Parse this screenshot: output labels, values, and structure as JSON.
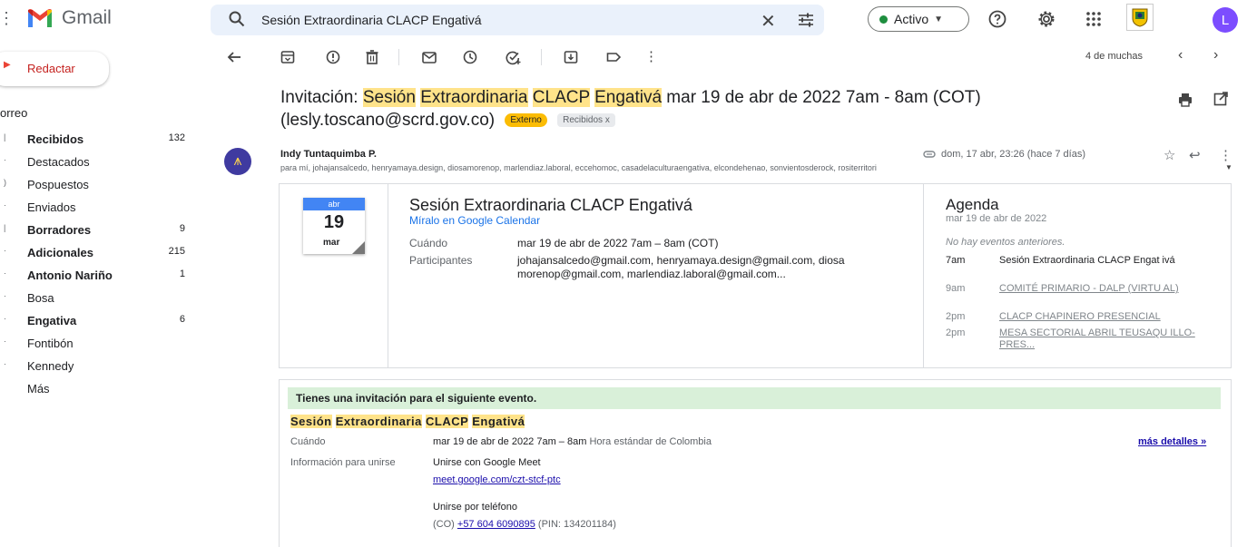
{
  "header": {
    "app_name": "Gmail",
    "search_value": "Sesión Extraordinaria CLACP Engativá",
    "status_label": "Activo",
    "avatar_letter": "L"
  },
  "sidebar": {
    "compose_label": "Redactar",
    "section_label": "orreo",
    "items": [
      {
        "label": "Recibidos",
        "count": "132",
        "bold": true
      },
      {
        "label": "Destacados",
        "count": ""
      },
      {
        "label": "Pospuestos",
        "count": ""
      },
      {
        "label": "Enviados",
        "count": ""
      },
      {
        "label": "Borradores",
        "count": "9",
        "bold": true
      },
      {
        "label": "Adicionales",
        "count": "215",
        "bold": true
      },
      {
        "label": "Antonio Nariño",
        "count": "1",
        "bold": true
      },
      {
        "label": "Bosa",
        "count": ""
      },
      {
        "label": "Engativa",
        "count": "6",
        "bold": true
      },
      {
        "label": "Fontibón",
        "count": ""
      },
      {
        "label": "Kennedy",
        "count": ""
      },
      {
        "label": "Más",
        "count": ""
      }
    ]
  },
  "toolbar": {
    "pager_text": "4 de muchas"
  },
  "message": {
    "subject_prefix": "Invitación: ",
    "subject_hl": [
      "Sesión",
      "Extraordinaria",
      "CLACP",
      "Engativá"
    ],
    "subject_suffix": " mar 19 de abr de 2022 7am - 8am (COT) (lesly.toscano@scrd.gov.co)",
    "tag_external": "Externo",
    "tag_inbox": "Recibidos x",
    "sender_name": "Indy Tuntaquimba P.",
    "recipients": "para mí, johajansalcedo, henryamaya.design, diosamorenop, marlendiaz.laboral, eccehomoc, casadelaculturaengativa, elcondehenao, sonvientosderock, rositerritori",
    "date": "dom, 17 abr, 23:26 (hace 7 días)"
  },
  "invite": {
    "cal_month": "abr",
    "cal_day": "19",
    "cal_weekday": "mar",
    "title": "Sesión Extraordinaria CLACP Engativá",
    "calendar_link": "Míralo en Google Calendar",
    "when_label": "Cuándo",
    "when_value": "mar 19 de abr de 2022 7am – 8am (COT)",
    "participants_label": "Participantes",
    "participants_value": "johajansalcedo@gmail.com, henryamaya.design@gmail.com, diosa morenop@gmail.com, marlendiaz.laboral@gmail.com..."
  },
  "agenda": {
    "title": "Agenda",
    "date": "mar 19 de abr de 2022",
    "no_previous": "No hay eventos anteriores.",
    "items": [
      {
        "time": "7am",
        "event": "Sesión Extraordinaria CLACP Engat ivá"
      },
      {
        "time": "9am",
        "event": "COMITÉ PRIMARIO - DALP (VIRTU AL)"
      },
      {
        "time": "2pm",
        "event": "CLACP CHAPINERO PRESENCIAL"
      },
      {
        "time": "2pm",
        "event": "MESA SECTORIAL ABRIL TEUSAQU ILLO-PRES..."
      }
    ]
  },
  "body": {
    "banner": "Tienes una invitación para el siguiente evento.",
    "title_words": [
      "Sesión",
      "Extraordinaria",
      "CLACP",
      "Engativá"
    ],
    "when_label": "Cuándo",
    "when_value": "mar 19 de abr de 2022 7am – 8am",
    "when_tz": "Hora estándar de Colombia",
    "more_details": "más detalles »",
    "join_label": "Información para unirse",
    "join_meet": "Unirse con Google Meet",
    "meet_link": "meet.google.com/czt-stcf-ptc",
    "join_phone": "Unirse por teléfono",
    "phone_prefix": "(CO) ",
    "phone_number": "+57 604 6090895",
    "phone_pin": " (PIN: 134201184)"
  },
  "colors": {
    "highlight": "#ffe38a",
    "banner": "#d9f0d9",
    "external_tag": "#fbbc04",
    "status_dot": "#1e8e3e",
    "avatar": "#7c4dff"
  }
}
